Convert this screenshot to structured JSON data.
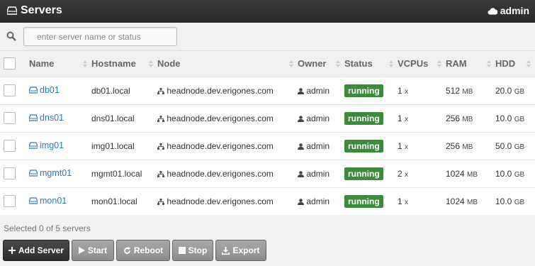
{
  "header": {
    "title": "Servers",
    "user": "admin"
  },
  "search": {
    "placeholder": "enter server name or status",
    "value": ""
  },
  "table": {
    "columns": [
      "Name",
      "Hostname",
      "Node",
      "Owner",
      "Status",
      "VCPUs",
      "RAM",
      "HDD"
    ],
    "rows": [
      {
        "name": "db01",
        "hostname": "db01.local",
        "node": "headnode.dev.erigones.com",
        "owner": "admin",
        "status": "running",
        "vcpus": "1",
        "vcpus_unit": "x",
        "ram": "512",
        "ram_unit": "MB",
        "hdd": "20.0",
        "hdd_unit": "GB"
      },
      {
        "name": "dns01",
        "hostname": "dns01.local",
        "node": "headnode.dev.erigones.com",
        "owner": "admin",
        "status": "running",
        "vcpus": "1",
        "vcpus_unit": "x",
        "ram": "256",
        "ram_unit": "MB",
        "hdd": "10.0",
        "hdd_unit": "GB"
      },
      {
        "name": "img01",
        "hostname": "img01.local",
        "node": "headnode.dev.erigones.com",
        "owner": "admin",
        "status": "running",
        "vcpus": "1",
        "vcpus_unit": "x",
        "ram": "256",
        "ram_unit": "MB",
        "hdd": "50.0",
        "hdd_unit": "GB"
      },
      {
        "name": "mgmt01",
        "hostname": "mgmt01.local",
        "node": "headnode.dev.erigones.com",
        "owner": "admin",
        "status": "running",
        "vcpus": "2",
        "vcpus_unit": "x",
        "ram": "1024",
        "ram_unit": "MB",
        "hdd": "10.0",
        "hdd_unit": "GB"
      },
      {
        "name": "mon01",
        "hostname": "mon01.local",
        "node": "headnode.dev.erigones.com",
        "owner": "admin",
        "status": "running",
        "vcpus": "1",
        "vcpus_unit": "x",
        "ram": "1024",
        "ram_unit": "MB",
        "hdd": "10.0",
        "hdd_unit": "GB"
      }
    ]
  },
  "footer": {
    "selection_text": "Selected 0 of 5 servers",
    "buttons": [
      "Add Server",
      "Start",
      "Reboot",
      "Stop",
      "Export"
    ]
  },
  "colors": {
    "status_running": "#3c8b3c",
    "link": "#2a7ab0",
    "topbar": "#2f2f2f"
  },
  "icons": {
    "server": "hdd-icon",
    "node": "sitemap-icon",
    "owner": "user-icon",
    "search": "search-icon",
    "header_user": "cloud-icon"
  }
}
